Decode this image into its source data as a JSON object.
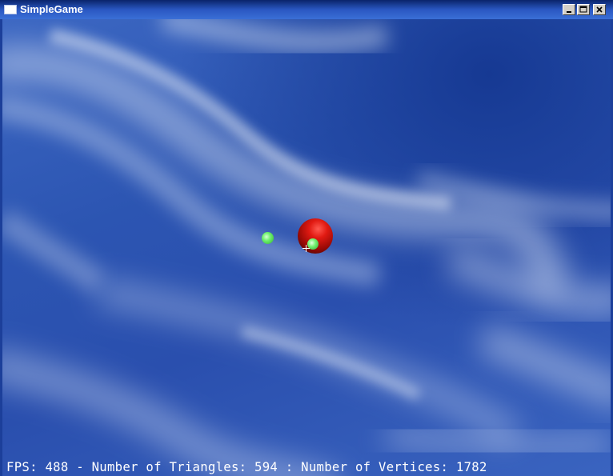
{
  "window": {
    "title": "SimpleGame",
    "icon": "app-window-icon",
    "controls": [
      "minimize-icon",
      "maximize-icon",
      "close-icon"
    ]
  },
  "scene": {
    "background": "cloudy blue sky",
    "sky_color": "#2c55b2",
    "objects": [
      {
        "name": "red-sphere",
        "color": "#e11a12"
      },
      {
        "name": "green-sphere",
        "color": "#6cf06a"
      },
      {
        "name": "green-sphere",
        "color": "#74f070"
      }
    ]
  },
  "hud": {
    "stats": "FPS: 488 - Number of Triangles: 594 : Number of Vertices: 1782"
  }
}
